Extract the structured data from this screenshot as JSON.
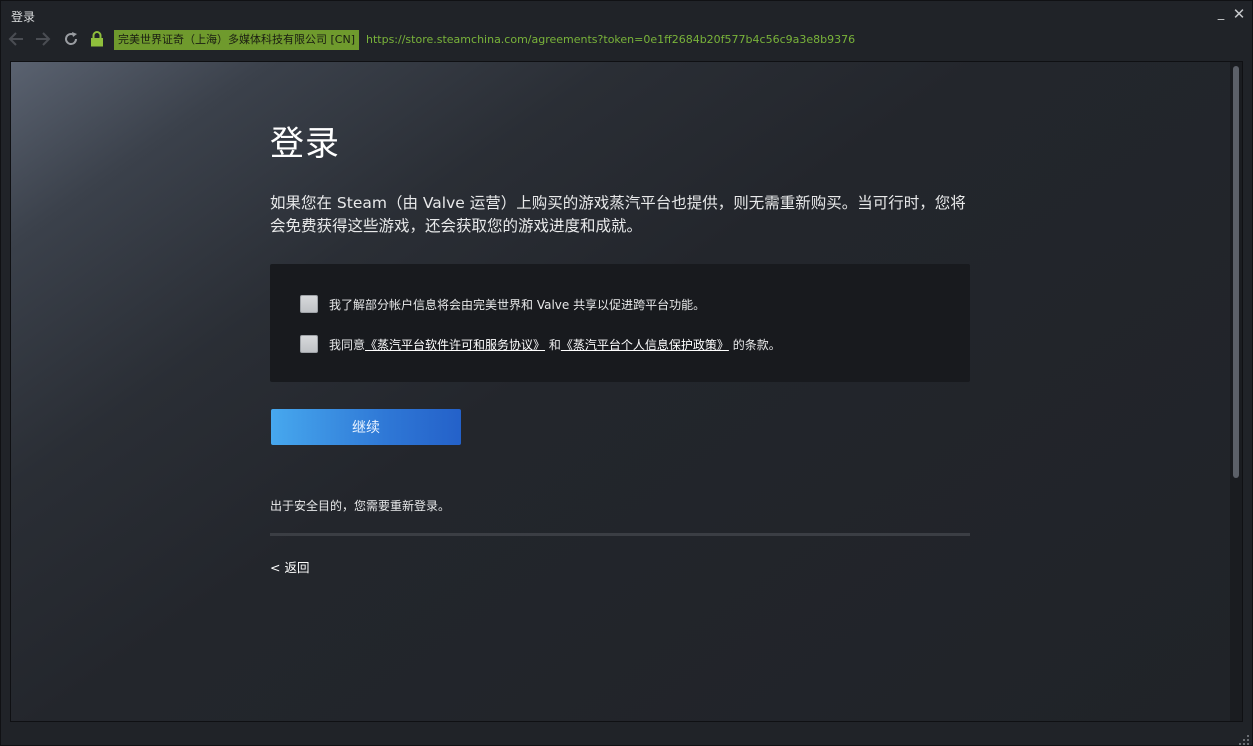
{
  "window": {
    "title": "登录",
    "minimize_label": "_",
    "close_label": "✕"
  },
  "navbar": {
    "back_icon": "arrow-left-icon",
    "forward_icon": "arrow-right-icon",
    "reload_icon": "reload-icon",
    "lock_icon": "lock-icon",
    "certificate": "完美世界证奇（上海）多媒体科技有限公司 [CN]",
    "url": "https://store.steamchina.com/agreements?token=0e1ff2684b20f577b4c56c9a3e8b9376"
  },
  "page": {
    "title": "登录",
    "intro": "如果您在 Steam（由 Valve 运营）上购买的游戏蒸汽平台也提供，则无需重新购买。当可行时，您将会免费获得这些游戏，还会获取您的游戏进度和成就。",
    "agreements": {
      "item1": "我了解部分帐户信息将会由完美世界和 Valve 共享以促进跨平台功能。",
      "item2_prefix": "我同意",
      "item2_link1": "《蒸汽平台软件许可和服务协议》",
      "item2_middle": "和",
      "item2_link2": "《蒸汽平台个人信息保护政策》",
      "item2_suffix": "的条款。"
    },
    "continue_label": "继续",
    "security_note": "出于安全目的，您需要重新登录。",
    "back_label": "< 返回"
  },
  "colors": {
    "background": "#202328",
    "accent_blue": "#2f78d6",
    "certificate_green": "#6f9a2d",
    "url_green": "#79b33a"
  }
}
